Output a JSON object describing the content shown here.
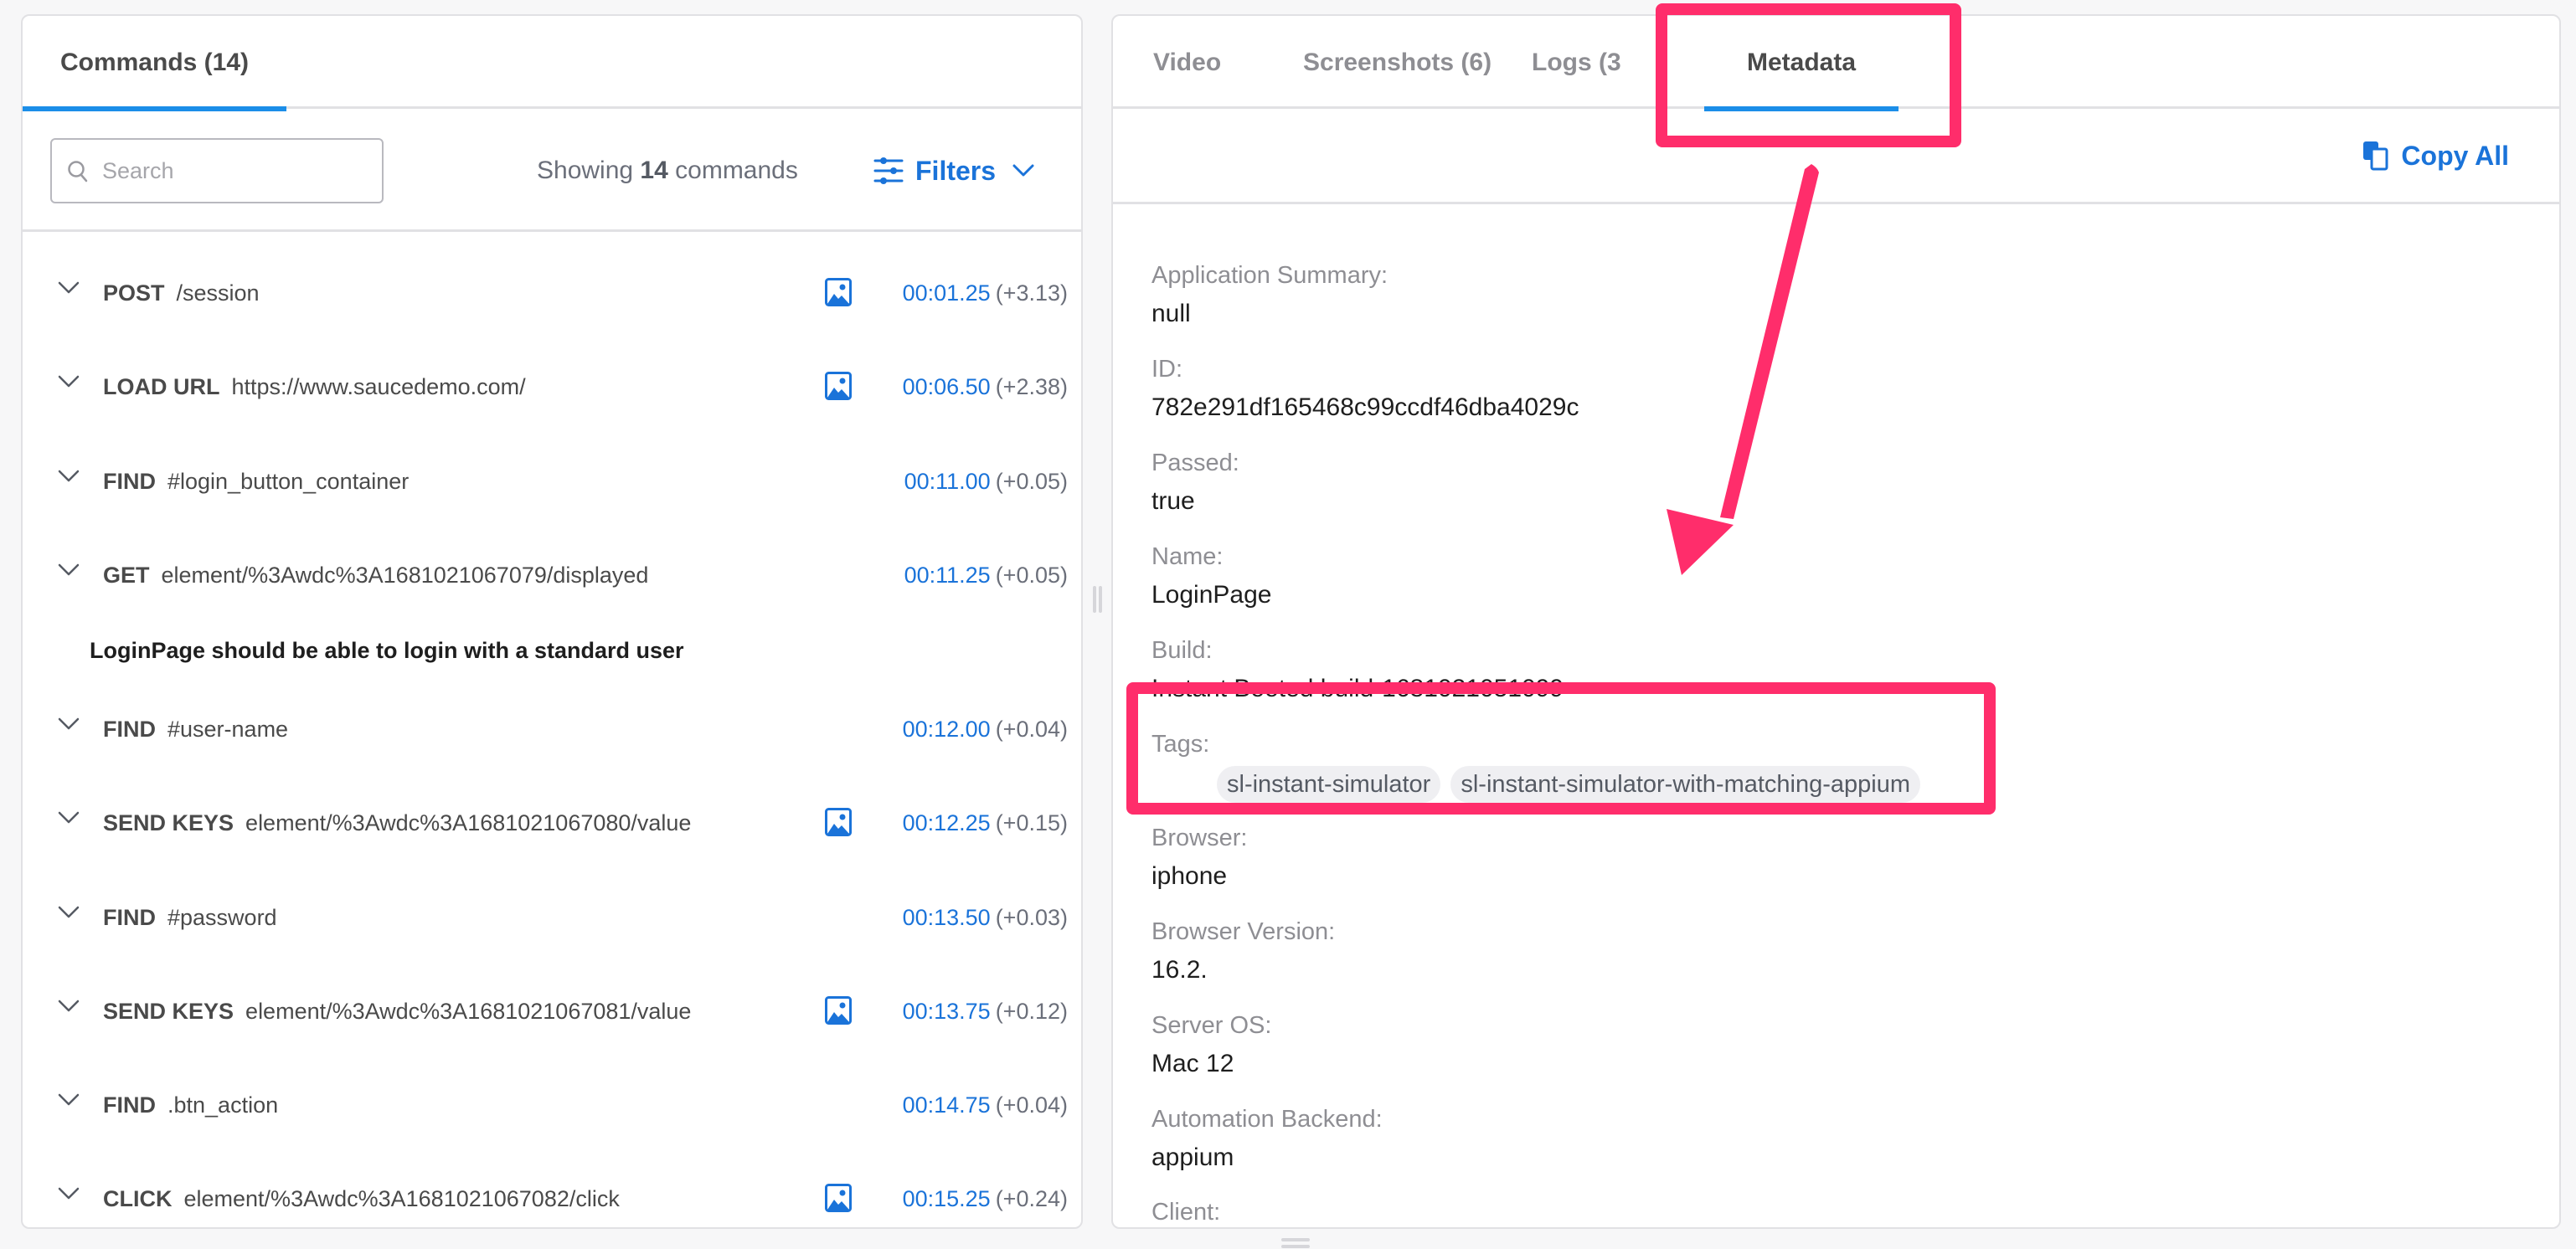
{
  "left_panel": {
    "tabs": [
      {
        "label": "Commands (14)",
        "active": true
      }
    ],
    "search": {
      "placeholder": "Search",
      "value": ""
    },
    "showing": {
      "prefix": "Showing",
      "count": "14",
      "suffix": "commands"
    },
    "filters_label": "Filters",
    "commands": [
      {
        "verb": "POST",
        "arg": "/session",
        "has_screenshot": true,
        "time": "00:01.25",
        "delta": "(+3.13)"
      },
      {
        "verb": "LOAD URL",
        "arg": "https://www.saucedemo.com/",
        "has_screenshot": true,
        "time": "00:06.50",
        "delta": "(+2.38)"
      },
      {
        "verb": "FIND",
        "arg": "#login_button_container",
        "has_screenshot": false,
        "time": "00:11.00",
        "delta": "(+0.05)"
      },
      {
        "verb": "GET",
        "arg": "element/%3Awdc%3A1681021067079/displayed",
        "has_screenshot": false,
        "time": "00:11.25",
        "delta": "(+0.05)"
      },
      {
        "verb": "FIND",
        "arg": "#user-name",
        "has_screenshot": false,
        "time": "00:12.00",
        "delta": "(+0.04)"
      },
      {
        "verb": "SEND KEYS",
        "arg": "element/%3Awdc%3A1681021067080/value",
        "has_screenshot": true,
        "time": "00:12.25",
        "delta": "(+0.15)"
      },
      {
        "verb": "FIND",
        "arg": "#password",
        "has_screenshot": false,
        "time": "00:13.50",
        "delta": "(+0.03)"
      },
      {
        "verb": "SEND KEYS",
        "arg": "element/%3Awdc%3A1681021067081/value",
        "has_screenshot": true,
        "time": "00:13.75",
        "delta": "(+0.12)"
      },
      {
        "verb": "FIND",
        "arg": ".btn_action",
        "has_screenshot": false,
        "time": "00:14.75",
        "delta": "(+0.04)"
      },
      {
        "verb": "CLICK",
        "arg": "element/%3Awdc%3A1681021067082/click",
        "has_screenshot": true,
        "time": "00:15.25",
        "delta": "(+0.24)"
      }
    ],
    "group_title": "LoginPage should be able to login with a standard user"
  },
  "right_panel": {
    "tabs": [
      {
        "label": "Video",
        "active": false
      },
      {
        "label": "Screenshots (6)",
        "active": false
      },
      {
        "label": "Logs (3",
        "active": false
      },
      {
        "label": "Metadata",
        "active": true
      }
    ],
    "copy_all_label": "Copy All",
    "metadata": [
      {
        "label": "Application Summary:",
        "value": "null"
      },
      {
        "label": "ID:",
        "value": "782e291df165468c99ccdf46dba4029c"
      },
      {
        "label": "Passed:",
        "value": "true"
      },
      {
        "label": "Name:",
        "value": "LoginPage"
      },
      {
        "label": "Build:",
        "value": "Instant Booted build-1681021051099"
      },
      {
        "label": "Tags:",
        "tags": [
          "sl-instant-simulator",
          "sl-instant-simulator-with-matching-appium"
        ]
      },
      {
        "label": "Browser:",
        "value": "iphone"
      },
      {
        "label": "Browser Version:",
        "value": "16.2."
      },
      {
        "label": "Server OS:",
        "value": "Mac 12"
      },
      {
        "label": "Automation Backend:",
        "value": "appium"
      },
      {
        "label": "Client:",
        "value": ""
      }
    ]
  },
  "annotations": {
    "highlight_color": "#ff2d6b",
    "targets": [
      "Metadata tab",
      "Tags field"
    ]
  },
  "colors": {
    "accent_blue": "#1a73d9",
    "tab_underline": "#1b8ee8",
    "border": "#e1e1e4"
  }
}
